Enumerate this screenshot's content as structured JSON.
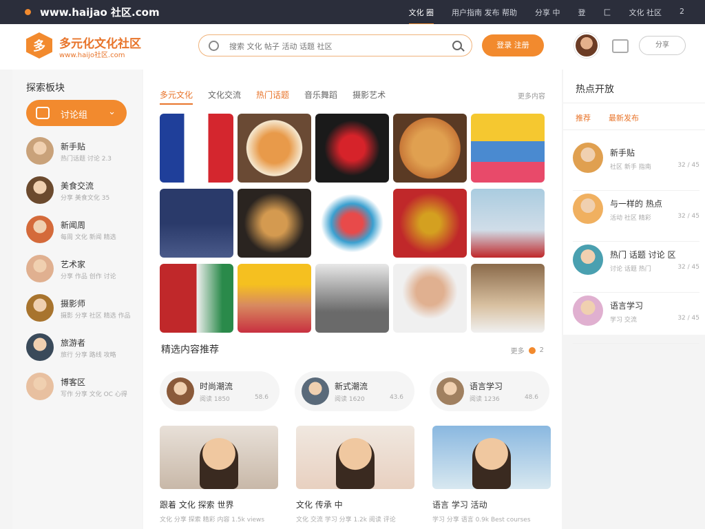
{
  "topbar": {
    "url": "www.haijao 社区.com",
    "links": [
      {
        "label": "文化 圈",
        "active": true
      },
      {
        "label": "用户指南 发布 帮助"
      },
      {
        "label": "分享 中"
      },
      {
        "label": "登"
      },
      {
        "label": "匚"
      },
      {
        "label": "文化 社区"
      },
      {
        "label": "2"
      }
    ]
  },
  "header": {
    "logo_mark": "多",
    "title": "多元化文化社区",
    "subtitle": "www.haijo社区.com",
    "search_placeholder": "搜索 文化 帖子 活动 话题 社区",
    "login_label": "登录 注册",
    "pill_label": "分享"
  },
  "left": {
    "title": "探索板块",
    "dropdown_label": "讨论组",
    "dropdown_chevron": "chevron-down-icon",
    "users": [
      {
        "name": "新手贴",
        "sub": "热门话题 讨论 2.3",
        "color": "#c9a27a"
      },
      {
        "name": "美食交流",
        "sub": "分享 美食文化 35",
        "color": "#6b4a2e"
      },
      {
        "name": "新闻周",
        "sub": "每周 文化 新闻 精选",
        "color": "#d46a3a"
      },
      {
        "name": "艺术家",
        "sub": "分享 作品 创作 讨论",
        "color": "#e0b090"
      },
      {
        "name": "摄影师",
        "sub": "摄影 分享 社区 精选 作品",
        "color": "#a8742e"
      },
      {
        "name": "旅游者",
        "sub": "旅行 分享 路线 攻略",
        "color": "#3a4a5a"
      },
      {
        "name": "博客区",
        "sub": "写作 分享 文化 OC 心得",
        "color": "#e8c0a0"
      }
    ]
  },
  "main": {
    "tabs": [
      {
        "label": "多元文化",
        "state": "on"
      },
      {
        "label": "文化交流",
        "state": ""
      },
      {
        "label": "热门话题",
        "state": "hot"
      },
      {
        "label": "音乐舞蹈",
        "state": ""
      },
      {
        "label": "摄影艺术",
        "state": ""
      }
    ],
    "more": "更多内容",
    "tiles": [
      {
        "name": "flag-tile",
        "bg": "linear-gradient(90deg,#1f3f9a 33%,#fff 33% 66%,#d4262e 66%)"
      },
      {
        "name": "food-plate-tile",
        "bg": "radial-gradient(circle,#e89a4a 30%,#f5e8d0 55%,#6a4a34 56%)"
      },
      {
        "name": "embroidery-tile",
        "bg": "radial-gradient(circle,#d6232a 25%,#1a1a1a 55%)"
      },
      {
        "name": "dish-tile",
        "bg": "radial-gradient(circle,#e0a050 35%,#c87838 60%,#5a3a24 61%)"
      },
      {
        "name": "textiles-tile",
        "bg": "linear-gradient(180deg,#f5c830 40%,#4a8ad0 40% 70%,#e84a6a 70%)"
      },
      {
        "name": "costume-figures-tile",
        "bg": "linear-gradient(180deg,#2a3a6a 50%,#4a5a8a)"
      },
      {
        "name": "dishes-set-tile",
        "bg": "radial-gradient(circle,#d49a50 25%,#2a2420 60%)"
      },
      {
        "name": "dancer-figure-tile",
        "bg": "radial-gradient(ellipse,#e84a4a 20%,#3aa0d0 40%,#fff 60%)"
      },
      {
        "name": "tapestry-tile",
        "bg": "radial-gradient(circle,#d4a020 20%,#c0282a 60%)"
      },
      {
        "name": "woman-portrait-tile",
        "bg": "linear-gradient(180deg,#aacce0,#d0dde8 60%,#c0282a)"
      },
      {
        "name": "flag-stripes-tile",
        "bg": "linear-gradient(90deg,#c0282a 50%,#f0f0f0 50%,#2a8a4a 85%)"
      },
      {
        "name": "headdress-woman-tile",
        "bg": "linear-gradient(180deg,#f5c020 30%,#d88a60 60%,#c83040)"
      },
      {
        "name": "man-portrait-tile",
        "bg": "linear-gradient(180deg,#e8e8e8,#6a6a6a 70%)"
      },
      {
        "name": "woman-portrait-2-tile",
        "bg": "radial-gradient(circle at 50% 40%,#e0b090 25%,#f0f0f0 50%)"
      },
      {
        "name": "woman-portrait-3-tile",
        "bg": "linear-gradient(180deg,#8a6a4a,#d8c0a0 60%,#f0f0f0)"
      }
    ],
    "section_title": "精选内容推荐",
    "pager": "更多",
    "pager_num": "2",
    "cats": [
      {
        "name": "时尚潮流",
        "sub": "阅读 1850",
        "right": "58.6",
        "color": "#8a5a3a"
      },
      {
        "name": "新式潮流",
        "sub": "阅读 1620",
        "right": "43.6",
        "color": "#5a6a7a"
      },
      {
        "name": "语言学习",
        "sub": "阅读 1236",
        "right": "48.6",
        "color": "#a08060"
      }
    ],
    "cards": [
      {
        "title": "跟着 文化 探索 世界",
        "sub": "文化 分享 探索 精彩 内容 1.5k views",
        "bg": "linear-gradient(180deg,#e8e0d8,#c8b8a8)"
      },
      {
        "title": "文化 传承 中",
        "sub": "文化 交流 学习 分享 1.2k 阅读 评论",
        "bg": "linear-gradient(180deg,#f0e8e0,#e8d0c0)"
      },
      {
        "title": "语言 学习 活动",
        "sub": "学习 分享 语言 0.9k Best courses",
        "bg": "linear-gradient(180deg,#8ab8e0,#d8e8f0)"
      }
    ]
  },
  "right": {
    "title": "热点开放",
    "sub_left": "推荐",
    "sub_right": "最新发布",
    "items": [
      {
        "name": "新手贴",
        "sub": "社区 新手 指南",
        "right": "32 / 45",
        "color": "#e0a050"
      },
      {
        "name": "与一样的 热点",
        "sub": "活动 社区 精彩",
        "right": "32 / 45",
        "color": "#f0b060"
      },
      {
        "name": "热门 话题 讨论 区",
        "sub": "讨论 话题 热门",
        "right": "32 / 45",
        "color": "#4aa0b0"
      },
      {
        "name": "语言学习",
        "sub": "学习 交流",
        "right": "32 / 45",
        "color": "#e0b0d0"
      }
    ]
  }
}
